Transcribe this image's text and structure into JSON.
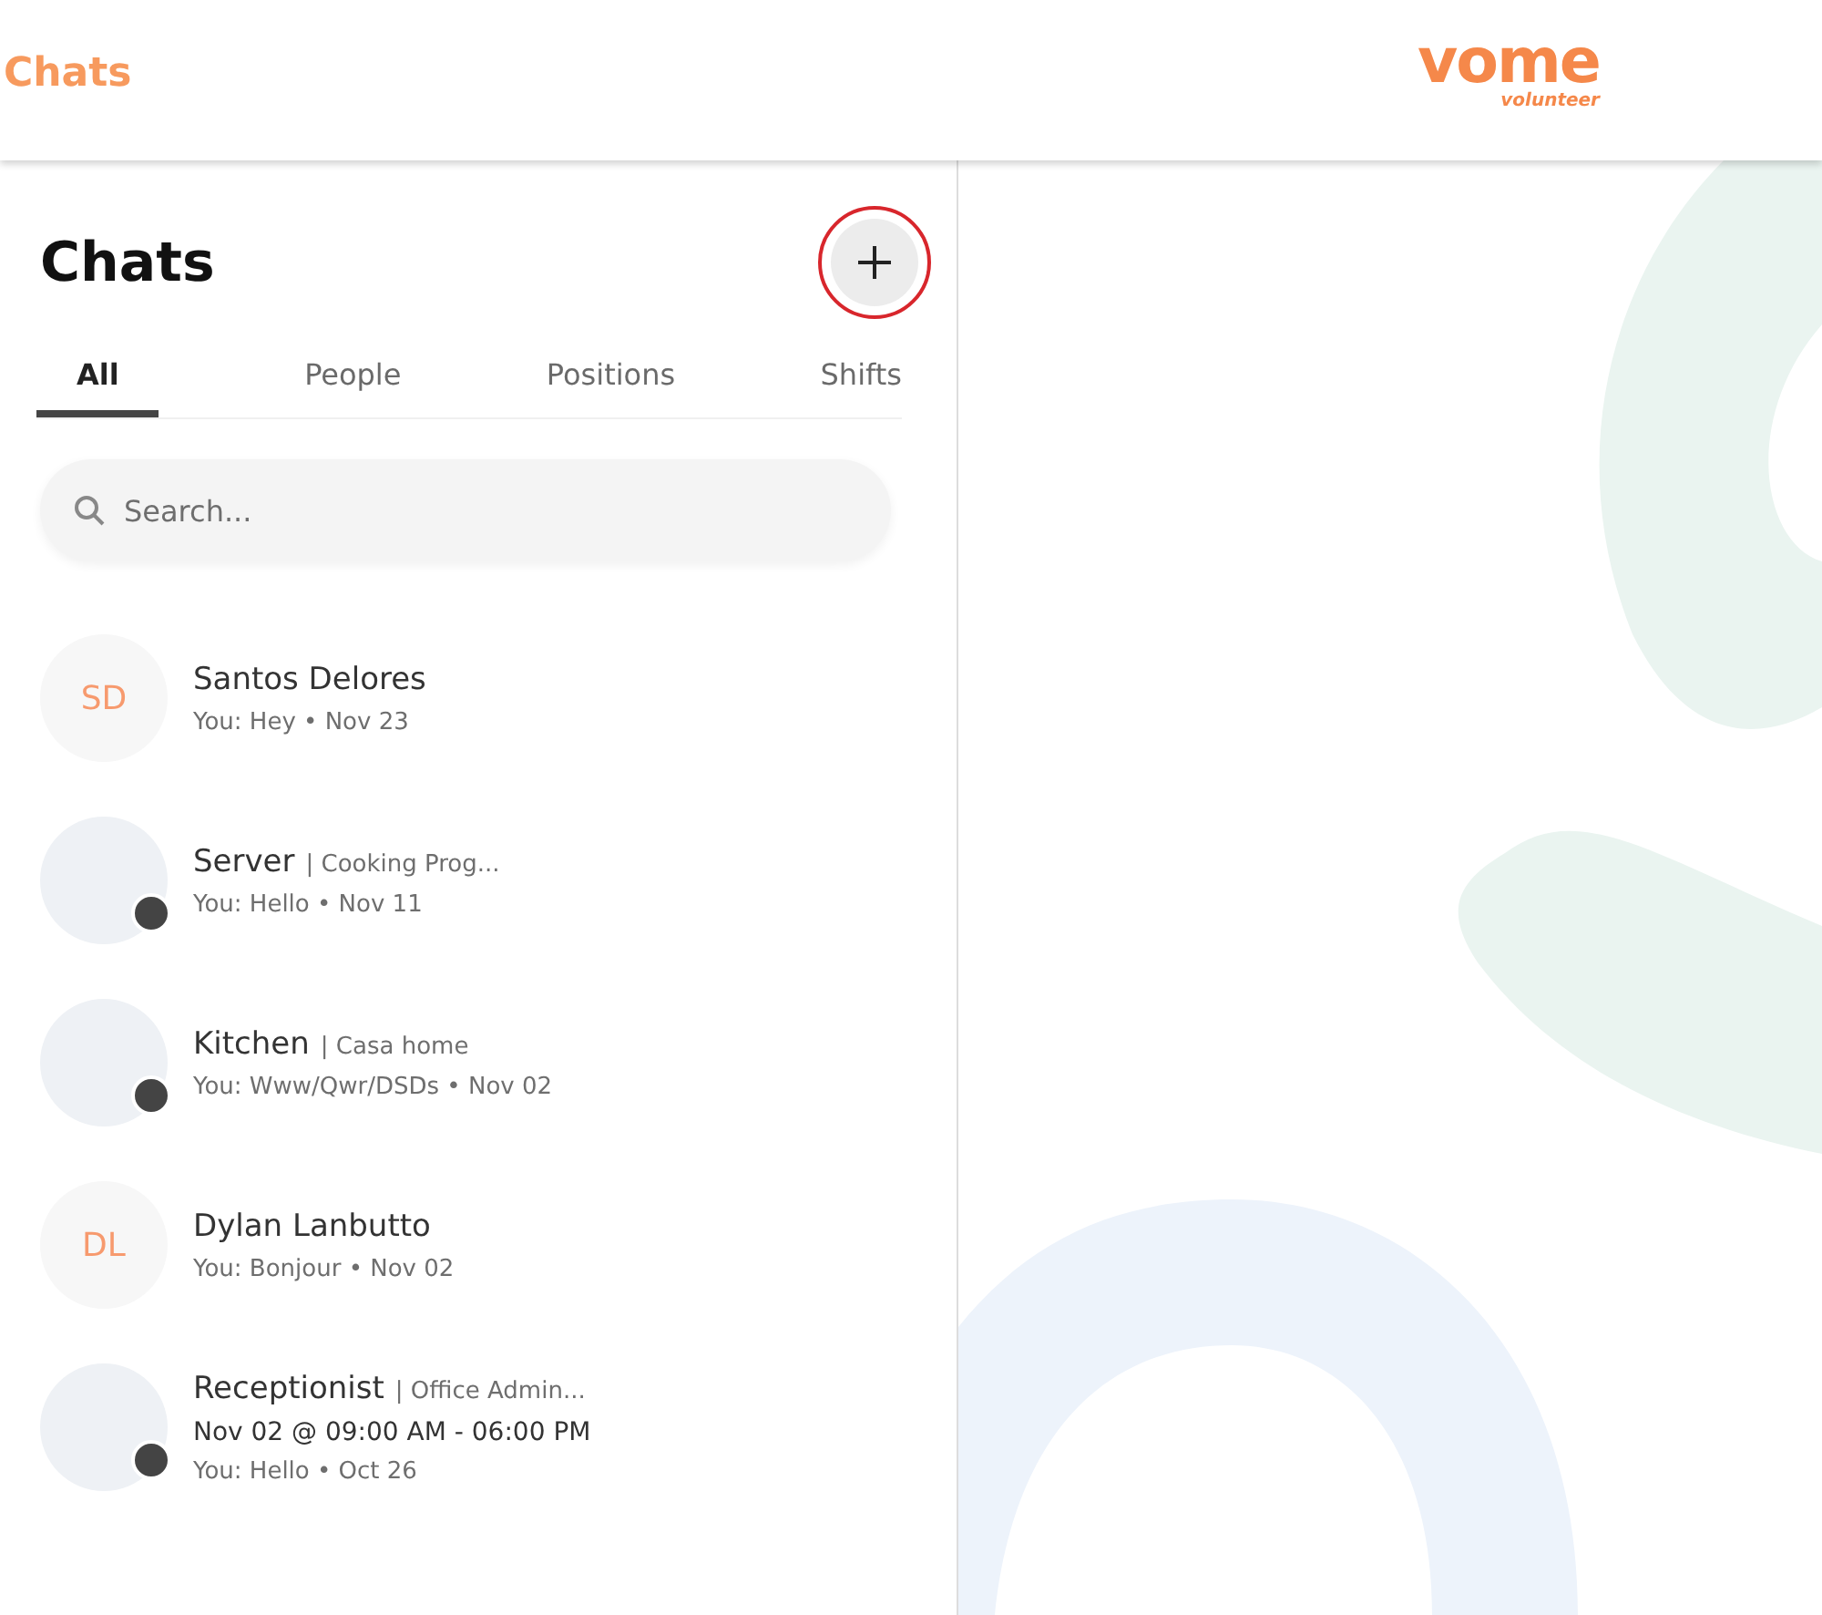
{
  "header": {
    "title": "Chats",
    "logo": {
      "wordmark": "vome",
      "tagline": "volunteer"
    }
  },
  "panel": {
    "title": "Chats",
    "new_chat_highlighted": true,
    "tabs": [
      {
        "label": "All",
        "selected": true
      },
      {
        "label": "People",
        "selected": false
      },
      {
        "label": "Positions",
        "selected": false
      },
      {
        "label": "Shifts",
        "selected": false
      }
    ],
    "search": {
      "placeholder": "Search..."
    },
    "chats": [
      {
        "kind": "person",
        "initials": "SD",
        "name": "Santos Delores",
        "preview": "You: Hey • Nov 23"
      },
      {
        "kind": "group",
        "name": "Server",
        "context": "| Cooking Prog...",
        "preview": "You: Hello • Nov 11"
      },
      {
        "kind": "group",
        "name": "Kitchen",
        "context": "| Casa home",
        "preview": "You: Www/Qwr/DSDs • Nov 02"
      },
      {
        "kind": "person",
        "initials": "DL",
        "name": "Dylan Lanbutto",
        "preview": "You: Bonjour • Nov 02"
      },
      {
        "kind": "group",
        "name": "Receptionist",
        "context": "| Office Admin...",
        "schedule": "Nov 02 @ 09:00 AM - 06:00 PM",
        "preview": "You: Hello • Oct 26"
      }
    ]
  }
}
